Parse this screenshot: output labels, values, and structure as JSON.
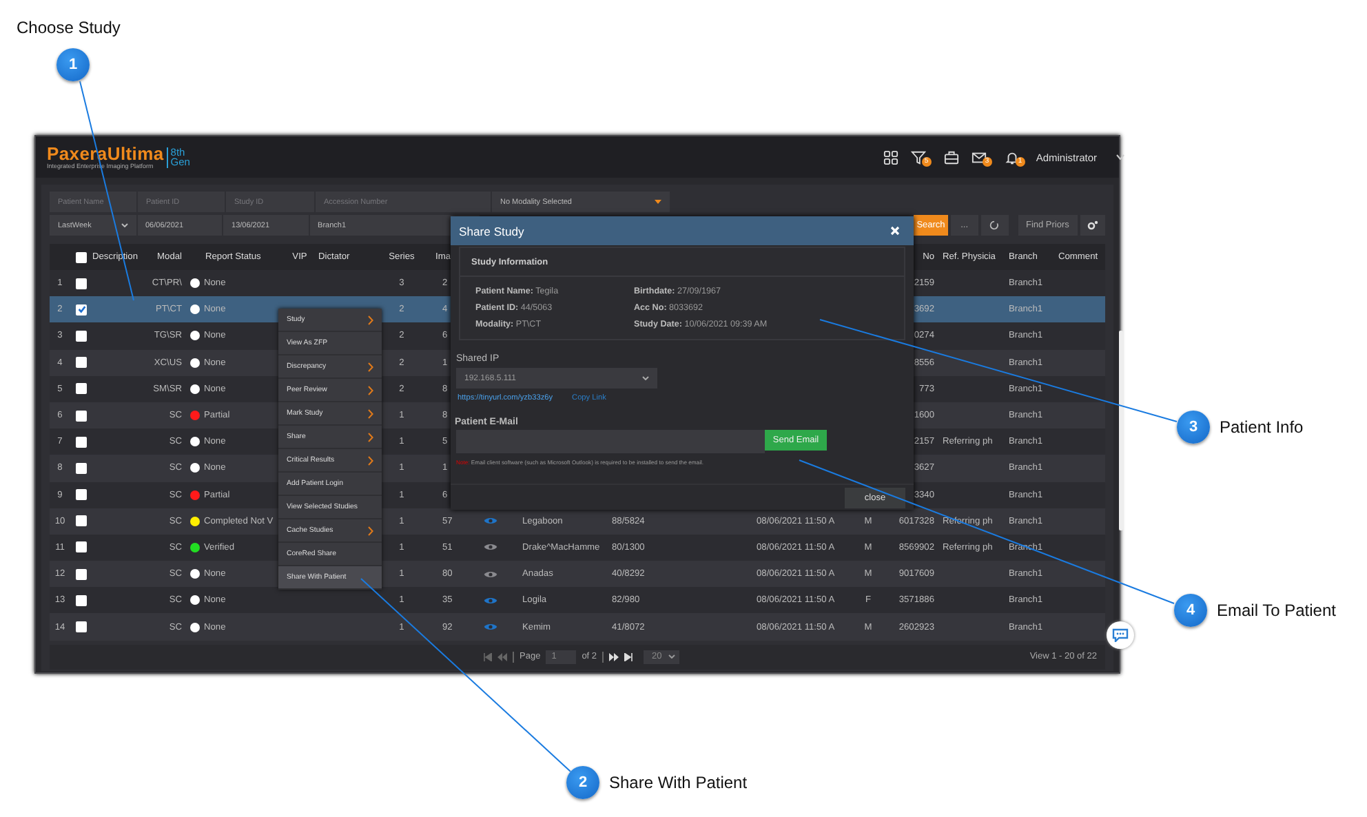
{
  "page": {
    "title": "Choose Study"
  },
  "callouts": [
    {
      "number": "1"
    },
    {
      "number": "2",
      "label": "Share With Patient"
    },
    {
      "number": "3",
      "label": "Patient Info"
    },
    {
      "number": "4",
      "label": "Email To Patient"
    }
  ],
  "app": {
    "logo": {
      "name_a": "Paxera",
      "name_b": "Ultima",
      "edition_a": "8th",
      "edition_b": "Gen",
      "tagline": "Integrated Enterprise Imaging Platform"
    },
    "toolbar": [
      {
        "kind": "grid"
      },
      {
        "kind": "filter",
        "badge": "5"
      },
      {
        "kind": "case"
      },
      {
        "kind": "mail",
        "badge": "3"
      },
      {
        "kind": "bell",
        "badge": "1"
      }
    ],
    "user": "Administrator"
  },
  "filters": {
    "patient_name": {
      "placeholder": "Patient Name"
    },
    "patient_id": {
      "placeholder": "Patient ID"
    },
    "study_id": {
      "placeholder": "Study ID"
    },
    "accession_number": {
      "placeholder": "Accession Number"
    },
    "modality": "No Modality Selected",
    "period": "LastWeek",
    "date_from": "06/06/2021",
    "date_to": "13/06/2021",
    "branch": "Branch1",
    "search": "Search",
    "more": "...",
    "find_priors": "Find Priors"
  },
  "table": {
    "select_all_checked": false,
    "columns": {
      "description": "Description",
      "modality": "Modal",
      "report_status": "Report Status",
      "vip": "VIP",
      "dictator": "Dictator",
      "series": "Series",
      "images": "Ima",
      "accession_no": "No",
      "ref_physician": "Ref. Physicia",
      "branch": "Branch",
      "comment": "Comment"
    },
    "rows": [
      {
        "number": "1",
        "checked": false,
        "selected": false,
        "modality": "CT\\PR\\",
        "report_status": "None",
        "color": "#ffffff",
        "series": "3",
        "images": "2",
        "accession_no": "2159",
        "branch": "Branch1"
      },
      {
        "number": "2",
        "checked": true,
        "selected": true,
        "modality": "PT\\CT",
        "report_status": "None",
        "color": "#ffffff",
        "series": "2",
        "images": "4",
        "accession_no": "3692",
        "branch": "Branch1"
      },
      {
        "number": "3",
        "checked": false,
        "selected": false,
        "modality": "TG\\SR",
        "report_status": "None",
        "color": "#ffffff",
        "series": "2",
        "images": "6",
        "accession_no": "0274",
        "branch": "Branch1"
      },
      {
        "number": "4",
        "checked": false,
        "selected": false,
        "modality": "XC\\US",
        "report_status": "None",
        "color": "#ffffff",
        "series": "2",
        "images": "1",
        "accession_no": "8556",
        "branch": "Branch1"
      },
      {
        "number": "5",
        "checked": false,
        "selected": false,
        "modality": "SM\\SR",
        "report_status": "None",
        "color": "#ffffff",
        "series": "2",
        "images": "8",
        "accession_no": "773",
        "branch": "Branch1"
      },
      {
        "number": "6",
        "checked": false,
        "selected": false,
        "modality": "SC",
        "report_status": "Partial",
        "color": "#ff1a1a",
        "series": "1",
        "images": "8",
        "accession_no": "1600",
        "branch": "Branch1"
      },
      {
        "number": "7",
        "checked": false,
        "selected": false,
        "modality": "SC",
        "report_status": "None",
        "color": "#ffffff",
        "series": "1",
        "images": "5",
        "accession_no": "2157",
        "ref_physician": "Referring ph",
        "branch": "Branch1"
      },
      {
        "number": "8",
        "checked": false,
        "selected": false,
        "modality": "SC",
        "report_status": "None",
        "color": "#ffffff",
        "series": "1",
        "images": "1",
        "accession_no": "3627",
        "branch": "Branch1"
      },
      {
        "number": "9",
        "checked": false,
        "selected": false,
        "modality": "SC",
        "report_status": "Partial",
        "color": "#ff1a1a",
        "series": "1",
        "images": "6",
        "accession_no": "3340",
        "branch": "Branch1"
      },
      {
        "number": "10",
        "checked": false,
        "selected": false,
        "modality": "SC",
        "report_status": "Completed Not V",
        "color": "#ffee00",
        "series": "1",
        "images": "57",
        "eye": {
          "highlighted": true
        },
        "patient_name": "Legaboon",
        "patient_id": "88/5824",
        "study_date": "08/06/2021 11:50 A",
        "sex": "M",
        "accession_no": "6017328",
        "ref_physician": "Referring ph",
        "branch": "Branch1"
      },
      {
        "number": "11",
        "checked": false,
        "selected": false,
        "modality": "SC",
        "report_status": "Verified",
        "color": "#22dd22",
        "series": "1",
        "images": "51",
        "eye": {
          "highlighted": false
        },
        "patient_name": "Drake^MacHamme",
        "patient_id": "80/1300",
        "study_date": "08/06/2021 11:50 A",
        "sex": "M",
        "accession_no": "8569902",
        "ref_physician": "Referring ph",
        "branch": "Branch1"
      },
      {
        "number": "12",
        "checked": false,
        "selected": false,
        "modality": "SC",
        "report_status": "None",
        "color": "#ffffff",
        "series": "1",
        "images": "80",
        "eye": {
          "highlighted": false
        },
        "patient_name": "Anadas",
        "patient_id": "40/8292",
        "study_date": "08/06/2021 11:50 A",
        "sex": "M",
        "accession_no": "9017609",
        "branch": "Branch1"
      },
      {
        "number": "13",
        "checked": false,
        "selected": false,
        "modality": "SC",
        "report_status": "None",
        "color": "#ffffff",
        "series": "1",
        "images": "35",
        "eye": {
          "highlighted": true
        },
        "patient_name": "Logila",
        "patient_id": "82/980",
        "study_date": "08/06/2021 11:50 A",
        "sex": "F",
        "accession_no": "3571886",
        "branch": "Branch1"
      },
      {
        "number": "14",
        "checked": false,
        "selected": false,
        "modality": "SC",
        "report_status": "None",
        "color": "#ffffff",
        "series": "1",
        "images": "92",
        "eye": {
          "highlighted": true
        },
        "patient_name": "Kemim",
        "patient_id": "41/8072",
        "study_date": "08/06/2021 11:50 A",
        "sex": "M",
        "accession_no": "2602923",
        "branch": "Branch1"
      }
    ]
  },
  "pagination": {
    "page_label": "Page",
    "page": "1",
    "of": "of 2",
    "page_size": "20",
    "summary": "View 1 - 20 of 22"
  },
  "context_menu": [
    {
      "label": "Study",
      "submenu": true,
      "selected": false
    },
    {
      "label": "View As ZFP",
      "submenu": false,
      "selected": false
    },
    {
      "label": "Discrepancy",
      "submenu": true,
      "selected": false
    },
    {
      "label": "Peer Review",
      "submenu": true,
      "selected": false
    },
    {
      "label": "Mark Study",
      "submenu": true,
      "selected": false
    },
    {
      "label": "Share",
      "submenu": true,
      "selected": false
    },
    {
      "label": "Critical Results",
      "submenu": true,
      "selected": false
    },
    {
      "label": "Add Patient Login",
      "submenu": false,
      "selected": false
    },
    {
      "label": "View Selected Studies",
      "submenu": false,
      "selected": false
    },
    {
      "label": "Cache Studies",
      "submenu": true,
      "selected": false
    },
    {
      "label": "CoreRed Share",
      "submenu": false,
      "selected": false
    },
    {
      "label": "Share With Patient",
      "submenu": false,
      "selected": true
    }
  ],
  "modal": {
    "title": "Share Study",
    "section_title": "Study Information",
    "fields": [
      "**Patient Name:** Tegila",
      "**Birthdate:** 27/09/1967",
      "**Patient ID:** 44/5063",
      "**Acc No:** 8033692",
      "**Modality:** PT\\CT",
      "**Study Date:** 10/06/2021 09:39 AM"
    ],
    "shared_ip_label": "Shared IP",
    "shared_ip": "192.168.5.111",
    "link": "https://tinyurl.com/yzb33z6y",
    "copy_link": "Copy Link",
    "email_label": "Patient E-Mail",
    "send_button": "Send Email",
    "note_label": "Note:",
    "note": "Email client software (such as Microsoft Outlook) is required to be installed to send the email.",
    "close": "close"
  }
}
